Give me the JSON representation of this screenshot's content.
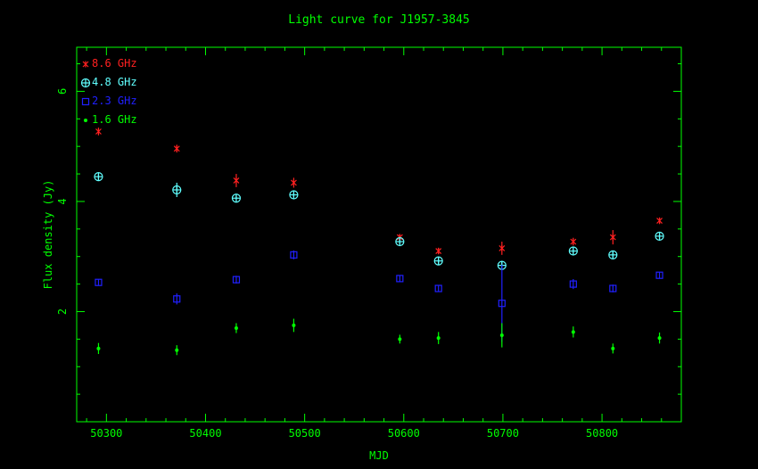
{
  "chart_data": {
    "type": "scatter",
    "title": "Light curve for J1957-3845",
    "xlabel": "MJD",
    "ylabel": "Flux density (Jy)",
    "xlim": [
      50270,
      50880
    ],
    "ylim": [
      0,
      6.8
    ],
    "x_ticks": [
      50300,
      50400,
      50500,
      50600,
      50700,
      50800
    ],
    "y_ticks": [
      2,
      4,
      6
    ],
    "legend_position": "top-left",
    "colors": {
      "axes": "#00ff00",
      "title": "#00ff00"
    },
    "series": [
      {
        "name": "8.6 GHz",
        "color": "#ff2020",
        "marker": "star",
        "points": [
          {
            "x": 50292,
            "y": 5.27,
            "err": 0.07
          },
          {
            "x": 50371,
            "y": 4.96,
            "err": 0.07
          },
          {
            "x": 50431,
            "y": 4.38,
            "err": 0.12
          },
          {
            "x": 50489,
            "y": 4.34,
            "err": 0.09
          },
          {
            "x": 50596,
            "y": 3.35,
            "err": 0.06
          },
          {
            "x": 50635,
            "y": 3.1,
            "err": 0.06
          },
          {
            "x": 50699,
            "y": 3.15,
            "err": 0.12
          },
          {
            "x": 50771,
            "y": 3.27,
            "err": 0.07
          },
          {
            "x": 50811,
            "y": 3.35,
            "err": 0.13
          },
          {
            "x": 50858,
            "y": 3.65,
            "err": 0.06
          }
        ]
      },
      {
        "name": "4.8 GHz",
        "color": "#60ffff",
        "marker": "circle-plus",
        "points": [
          {
            "x": 50292,
            "y": 4.45,
            "err": 0.06
          },
          {
            "x": 50371,
            "y": 4.21,
            "err": 0.13
          },
          {
            "x": 50431,
            "y": 4.06,
            "err": 0.05
          },
          {
            "x": 50489,
            "y": 4.12,
            "err": 0.05
          },
          {
            "x": 50596,
            "y": 3.27,
            "err": 0.05
          },
          {
            "x": 50635,
            "y": 2.92,
            "err": 0.06
          },
          {
            "x": 50699,
            "y": 2.84,
            "err": 0.08
          },
          {
            "x": 50771,
            "y": 3.1,
            "err": 0.06
          },
          {
            "x": 50811,
            "y": 3.03,
            "err": 0.06
          },
          {
            "x": 50858,
            "y": 3.37,
            "err": 0.07
          }
        ]
      },
      {
        "name": "2.3 GHz",
        "color": "#2020ff",
        "marker": "square",
        "points": [
          {
            "x": 50292,
            "y": 2.53,
            "err": 0.05
          },
          {
            "x": 50371,
            "y": 2.23,
            "err": 0.1
          },
          {
            "x": 50431,
            "y": 2.58,
            "err": 0.07
          },
          {
            "x": 50489,
            "y": 3.03,
            "err": 0.08
          },
          {
            "x": 50596,
            "y": 2.6,
            "err": 0.06
          },
          {
            "x": 50635,
            "y": 2.42,
            "err": 0.06
          },
          {
            "x": 50699,
            "y": 2.15,
            "err": 0.7
          },
          {
            "x": 50771,
            "y": 2.5,
            "err": 0.09
          },
          {
            "x": 50811,
            "y": 2.42,
            "err": 0.07
          },
          {
            "x": 50858,
            "y": 2.66,
            "err": 0.06
          }
        ]
      },
      {
        "name": "1.6 GHz",
        "color": "#00ff00",
        "marker": "dot",
        "points": [
          {
            "x": 50292,
            "y": 1.33,
            "err": 0.1
          },
          {
            "x": 50371,
            "y": 1.3,
            "err": 0.09
          },
          {
            "x": 50431,
            "y": 1.7,
            "err": 0.09
          },
          {
            "x": 50489,
            "y": 1.75,
            "err": 0.12
          },
          {
            "x": 50596,
            "y": 1.5,
            "err": 0.08
          },
          {
            "x": 50635,
            "y": 1.52,
            "err": 0.11
          },
          {
            "x": 50699,
            "y": 1.57,
            "err": 0.22
          },
          {
            "x": 50771,
            "y": 1.63,
            "err": 0.1
          },
          {
            "x": 50811,
            "y": 1.33,
            "err": 0.09
          },
          {
            "x": 50858,
            "y": 1.52,
            "err": 0.1
          }
        ]
      }
    ]
  }
}
